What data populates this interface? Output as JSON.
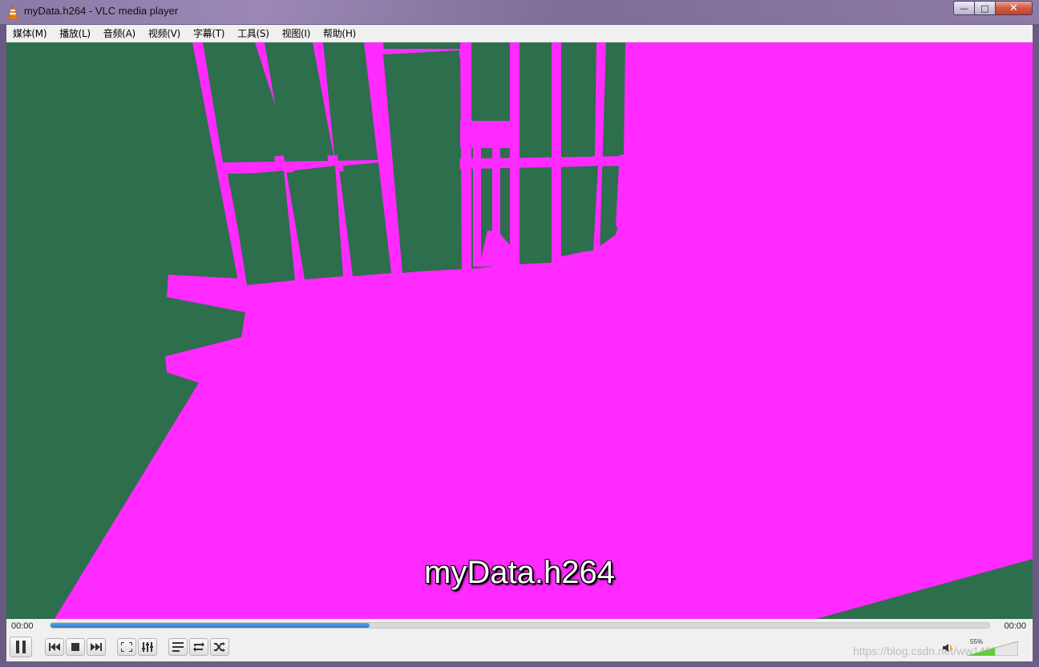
{
  "window": {
    "title": "myData.h264 - VLC media player",
    "controls": {
      "minimize": "—",
      "maximize": "□",
      "close": "✕"
    }
  },
  "menu": [
    {
      "label": "媒体(M)"
    },
    {
      "label": "播放(L)"
    },
    {
      "label": "音频(A)"
    },
    {
      "label": "视频(V)"
    },
    {
      "label": "字幕(T)"
    },
    {
      "label": "工具(S)"
    },
    {
      "label": "视图(I)"
    },
    {
      "label": "帮助(H)"
    }
  ],
  "video": {
    "overlay_text": "myData.h264",
    "colors": {
      "background": "#2d6e4c",
      "foreground": "#ff2aff"
    }
  },
  "playback": {
    "elapsed": "00:00",
    "total": "00:00",
    "progress": 0.34
  },
  "buttons": {
    "pause": "pause-icon",
    "previous": "previous-icon",
    "stop": "stop-icon",
    "next": "next-icon",
    "fullscreen": "fullscreen-icon",
    "extended_settings": "equalizer-icon",
    "playlist": "playlist-icon",
    "loop": "loop-icon",
    "random": "shuffle-icon"
  },
  "volume": {
    "percent_label": "55%",
    "level": 0.55
  },
  "watermark": "https://blog.csdn.net/ww1407101"
}
